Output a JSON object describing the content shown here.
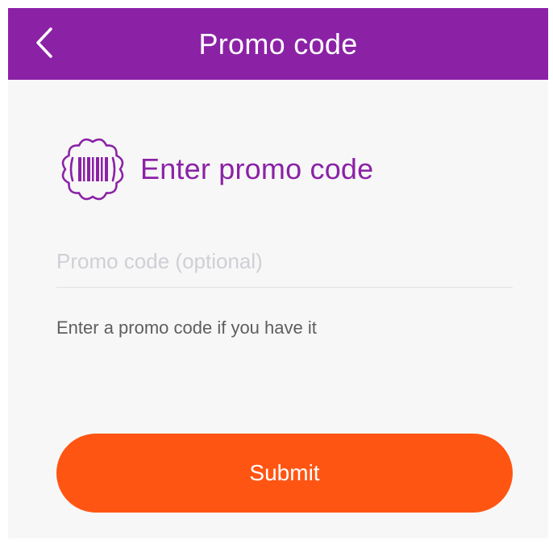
{
  "header": {
    "title": "Promo code",
    "back_icon": "chevron-left-icon"
  },
  "main": {
    "heading": "Enter promo code",
    "heading_icon": "barcode-badge-icon",
    "input": {
      "value": "",
      "placeholder": "Promo code (optional)"
    },
    "helper_text": "Enter a promo code if you have it",
    "submit_label": "Submit"
  },
  "colors": {
    "brand_purple": "#8b22a6",
    "accent_orange": "#ff5513",
    "background": "#f7f7f7"
  }
}
